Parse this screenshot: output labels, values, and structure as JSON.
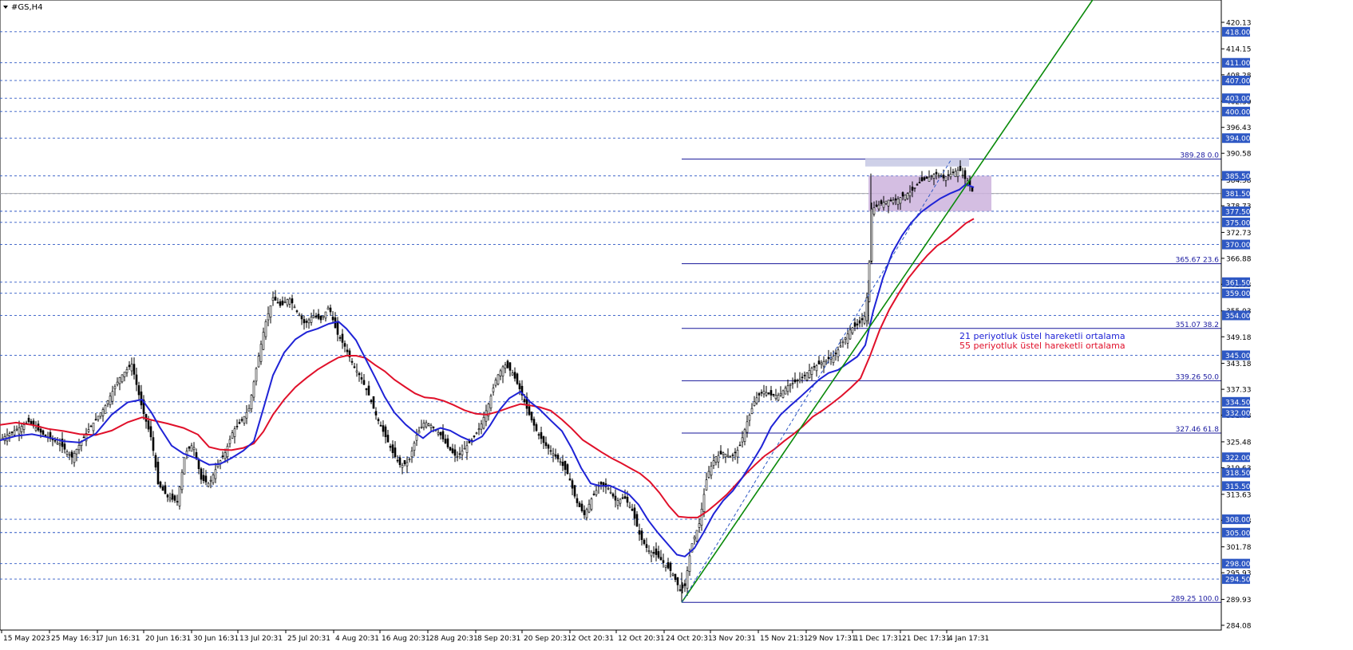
{
  "window": {
    "title": "#GS,H4"
  },
  "legend": {
    "items": [
      {
        "label": "21 periyotluk üstel hareketli ortalama",
        "color": "#1f23d6"
      },
      {
        "label": "55 periyotluk üstel hareketli ortalama",
        "color": "#e0102a"
      }
    ]
  },
  "colors": {
    "background": "#ffffff",
    "candle": "#000000",
    "ema21": "#1f23d6",
    "ema55": "#e0102a",
    "trendline": "#0a8a0a",
    "fib_line": "#16169a",
    "fib_label": "#1a1aa0",
    "sr_line": "#2e58c4",
    "sr_tag_bg": "#2e58c4",
    "sr_tag_text": "#ffffff",
    "range_box": "#cdb3dd",
    "range_box_top": "#c9cbe6",
    "axis_text": "#000000"
  },
  "chart_data": {
    "type": "candlestick",
    "symbol": "#GS",
    "timeframe": "H4",
    "ylim": [
      284.08,
      424.0
    ],
    "price_axis_ticks": [
      "420.13",
      "414.15",
      "408.28",
      "402.30",
      "396.43",
      "390.58",
      "384.58",
      "378.73",
      "372.73",
      "366.88",
      "361.03",
      "355.03",
      "349.18",
      "343.18",
      "337.33",
      "331.48",
      "325.48",
      "319.63",
      "313.63",
      "307.78",
      "301.78",
      "295.93",
      "289.93",
      "284.08"
    ],
    "support_resistance_levels": [
      "418.00",
      "411.00",
      "407.00",
      "403.00",
      "400.00",
      "394.00",
      "385.50",
      "381.50",
      "377.50",
      "375.00",
      "370.00",
      "361.50",
      "359.00",
      "354.00",
      "345.00",
      "334.50",
      "332.00",
      "322.00",
      "318.50",
      "315.50",
      "308.00",
      "305.00",
      "298.00",
      "294.50"
    ],
    "fibonacci_levels": [
      {
        "price": 389.28,
        "label": "389.28 0.0"
      },
      {
        "price": 365.67,
        "label": "365.67 23.6"
      },
      {
        "price": 351.07,
        "label": "351.07 38.2"
      },
      {
        "price": 339.26,
        "label": "339.26 50.0"
      },
      {
        "price": 327.46,
        "label": "327.46 61.8"
      },
      {
        "price": 289.25,
        "label": "289.25 100.0"
      }
    ],
    "x_axis_labels": [
      "15 May 2023",
      "25 May 16:31",
      "7 Jun 16:31",
      "20 Jun 16:31",
      "30 Jun 16:31",
      "13 Jul 20:31",
      "25 Jul 20:31",
      "4 Aug 20:31",
      "16 Aug 20:31",
      "28 Aug 20:31",
      "8 Sep 20:31",
      "20 Sep 20:31",
      "2 Oct 20:31",
      "12 Oct 20:31",
      "24 Oct 20:31",
      "3 Nov 20:31",
      "15 Nov 21:31",
      "29 Nov 17:31",
      "11 Dec 17:31",
      "21 Dec 17:31",
      "4 Jan 17:31"
    ],
    "close_path": [
      [
        0,
        326
      ],
      [
        18,
        328
      ],
      [
        36,
        330
      ],
      [
        55,
        327
      ],
      [
        75,
        325
      ],
      [
        90,
        322
      ],
      [
        110,
        328
      ],
      [
        130,
        333
      ],
      [
        150,
        340
      ],
      [
        165,
        343
      ],
      [
        178,
        333
      ],
      [
        190,
        326
      ],
      [
        198,
        316
      ],
      [
        210,
        313
      ],
      [
        222,
        312
      ],
      [
        232,
        323
      ],
      [
        242,
        325
      ],
      [
        252,
        317
      ],
      [
        262,
        316
      ],
      [
        272,
        320
      ],
      [
        282,
        323
      ],
      [
        292,
        328
      ],
      [
        302,
        330
      ],
      [
        312,
        333
      ],
      [
        322,
        343
      ],
      [
        332,
        352
      ],
      [
        342,
        358
      ],
      [
        352,
        356
      ],
      [
        362,
        358
      ],
      [
        372,
        355
      ],
      [
        382,
        352
      ],
      [
        392,
        354
      ],
      [
        402,
        353
      ],
      [
        412,
        356
      ],
      [
        422,
        350
      ],
      [
        432,
        347
      ],
      [
        442,
        343
      ],
      [
        452,
        340
      ],
      [
        462,
        336
      ],
      [
        472,
        331
      ],
      [
        482,
        327
      ],
      [
        492,
        323
      ],
      [
        502,
        320
      ],
      [
        512,
        321
      ],
      [
        522,
        327
      ],
      [
        532,
        330
      ],
      [
        542,
        329
      ],
      [
        552,
        327
      ],
      [
        562,
        324
      ],
      [
        572,
        322
      ],
      [
        582,
        324
      ],
      [
        592,
        326
      ],
      [
        602,
        329
      ],
      [
        612,
        334
      ],
      [
        622,
        340
      ],
      [
        632,
        343
      ],
      [
        642,
        341
      ],
      [
        652,
        337
      ],
      [
        662,
        332
      ],
      [
        672,
        328
      ],
      [
        682,
        325
      ],
      [
        692,
        323
      ],
      [
        702,
        321
      ],
      [
        712,
        318
      ],
      [
        722,
        312
      ],
      [
        732,
        309
      ],
      [
        742,
        313
      ],
      [
        752,
        316
      ],
      [
        762,
        315
      ],
      [
        772,
        312
      ],
      [
        782,
        313
      ],
      [
        792,
        310
      ],
      [
        802,
        304
      ],
      [
        812,
        301
      ],
      [
        822,
        300
      ],
      [
        832,
        298
      ],
      [
        842,
        296
      ],
      [
        852,
        292
      ],
      [
        858,
        293
      ],
      [
        866,
        302
      ],
      [
        876,
        307
      ],
      [
        886,
        318
      ],
      [
        896,
        322
      ],
      [
        906,
        323
      ],
      [
        916,
        322
      ],
      [
        926,
        324
      ],
      [
        936,
        330
      ],
      [
        946,
        335
      ],
      [
        956,
        337
      ],
      [
        966,
        336
      ],
      [
        976,
        336
      ],
      [
        986,
        338
      ],
      [
        996,
        339
      ],
      [
        1006,
        340
      ],
      [
        1016,
        342
      ],
      [
        1026,
        343
      ],
      [
        1036,
        344
      ],
      [
        1046,
        345
      ],
      [
        1056,
        348
      ],
      [
        1066,
        351
      ],
      [
        1076,
        352
      ],
      [
        1084,
        354
      ],
      [
        1088,
        362
      ],
      [
        1092,
        378
      ],
      [
        1102,
        379
      ],
      [
        1112,
        380
      ],
      [
        1122,
        380
      ],
      [
        1132,
        381
      ],
      [
        1142,
        382
      ],
      [
        1152,
        384
      ],
      [
        1162,
        385
      ],
      [
        1172,
        386
      ],
      [
        1182,
        385
      ],
      [
        1192,
        386
      ],
      [
        1202,
        387
      ],
      [
        1208,
        385
      ],
      [
        1214,
        384
      ],
      [
        1220,
        381
      ]
    ],
    "candle_range_tolerance": 1.2,
    "ema21_path": [
      [
        0,
        325.8
      ],
      [
        20,
        326.8
      ],
      [
        40,
        327.2
      ],
      [
        60,
        326.5
      ],
      [
        80,
        325.6
      ],
      [
        100,
        325.3
      ],
      [
        120,
        327.3
      ],
      [
        140,
        331.6
      ],
      [
        160,
        334.4
      ],
      [
        178,
        335.0
      ],
      [
        190,
        332.0
      ],
      [
        200,
        328.8
      ],
      [
        215,
        324.6
      ],
      [
        230,
        322.8
      ],
      [
        248,
        321.6
      ],
      [
        262,
        320.3
      ],
      [
        276,
        320.5
      ],
      [
        290,
        321.8
      ],
      [
        305,
        323.5
      ],
      [
        318,
        325.6
      ],
      [
        330,
        333.0
      ],
      [
        342,
        340.5
      ],
      [
        356,
        345.6
      ],
      [
        370,
        348.6
      ],
      [
        384,
        350.2
      ],
      [
        398,
        351.0
      ],
      [
        412,
        352.1
      ],
      [
        424,
        352.6
      ],
      [
        434,
        351.0
      ],
      [
        446,
        348.4
      ],
      [
        458,
        344.2
      ],
      [
        470,
        340.0
      ],
      [
        482,
        335.6
      ],
      [
        494,
        332.1
      ],
      [
        508,
        329.4
      ],
      [
        520,
        327.6
      ],
      [
        530,
        326.3
      ],
      [
        540,
        327.8
      ],
      [
        552,
        328.6
      ],
      [
        564,
        328.0
      ],
      [
        578,
        326.6
      ],
      [
        592,
        325.5
      ],
      [
        604,
        326.7
      ],
      [
        614,
        329.2
      ],
      [
        626,
        332.7
      ],
      [
        638,
        335.3
      ],
      [
        652,
        336.8
      ],
      [
        664,
        334.5
      ],
      [
        676,
        332.8
      ],
      [
        690,
        330.3
      ],
      [
        704,
        327.9
      ],
      [
        716,
        324.1
      ],
      [
        728,
        319.6
      ],
      [
        740,
        316.1
      ],
      [
        752,
        315.5
      ],
      [
        764,
        315.6
      ],
      [
        776,
        314.6
      ],
      [
        788,
        313.6
      ],
      [
        800,
        311.3
      ],
      [
        812,
        307.8
      ],
      [
        824,
        305.0
      ],
      [
        836,
        302.5
      ],
      [
        848,
        300.0
      ],
      [
        858,
        299.6
      ],
      [
        870,
        301.5
      ],
      [
        882,
        305.2
      ],
      [
        894,
        309.2
      ],
      [
        906,
        312.2
      ],
      [
        918,
        314.4
      ],
      [
        930,
        317.4
      ],
      [
        942,
        320.8
      ],
      [
        954,
        324.4
      ],
      [
        966,
        328.8
      ],
      [
        978,
        331.6
      ],
      [
        990,
        333.6
      ],
      [
        1002,
        335.5
      ],
      [
        1014,
        337.5
      ],
      [
        1026,
        339.5
      ],
      [
        1038,
        341.0
      ],
      [
        1050,
        341.7
      ],
      [
        1062,
        343.2
      ],
      [
        1074,
        344.7
      ],
      [
        1084,
        347.3
      ],
      [
        1094,
        355.0
      ],
      [
        1106,
        362.4
      ],
      [
        1118,
        368.2
      ],
      [
        1130,
        372.0
      ],
      [
        1142,
        375.0
      ],
      [
        1154,
        377.3
      ],
      [
        1166,
        378.9
      ],
      [
        1178,
        380.4
      ],
      [
        1190,
        381.5
      ],
      [
        1202,
        382.4
      ],
      [
        1210,
        383.6
      ],
      [
        1220,
        382.9
      ]
    ],
    "ema55_path": [
      [
        0,
        329.3
      ],
      [
        20,
        329.8
      ],
      [
        40,
        329.3
      ],
      [
        60,
        328.4
      ],
      [
        80,
        327.9
      ],
      [
        100,
        327.2
      ],
      [
        120,
        327.0
      ],
      [
        140,
        328.0
      ],
      [
        160,
        329.9
      ],
      [
        178,
        331.0
      ],
      [
        190,
        330.4
      ],
      [
        210,
        329.6
      ],
      [
        230,
        328.6
      ],
      [
        248,
        327.1
      ],
      [
        262,
        324.3
      ],
      [
        276,
        323.7
      ],
      [
        290,
        323.6
      ],
      [
        305,
        324.1
      ],
      [
        318,
        325.1
      ],
      [
        330,
        327.8
      ],
      [
        342,
        331.6
      ],
      [
        356,
        335.0
      ],
      [
        370,
        337.8
      ],
      [
        384,
        339.9
      ],
      [
        398,
        341.8
      ],
      [
        412,
        343.3
      ],
      [
        424,
        344.5
      ],
      [
        434,
        344.9
      ],
      [
        446,
        344.9
      ],
      [
        458,
        344.4
      ],
      [
        470,
        342.8
      ],
      [
        482,
        341.4
      ],
      [
        494,
        339.5
      ],
      [
        508,
        337.8
      ],
      [
        520,
        336.4
      ],
      [
        532,
        335.5
      ],
      [
        544,
        335.3
      ],
      [
        556,
        334.7
      ],
      [
        568,
        333.8
      ],
      [
        582,
        332.6
      ],
      [
        596,
        331.8
      ],
      [
        610,
        331.6
      ],
      [
        624,
        332.3
      ],
      [
        638,
        333.2
      ],
      [
        652,
        334.0
      ],
      [
        664,
        333.7
      ],
      [
        676,
        333.3
      ],
      [
        690,
        332.5
      ],
      [
        704,
        330.5
      ],
      [
        716,
        328.5
      ],
      [
        730,
        325.9
      ],
      [
        742,
        324.5
      ],
      [
        754,
        323.1
      ],
      [
        766,
        321.8
      ],
      [
        778,
        320.7
      ],
      [
        790,
        319.5
      ],
      [
        802,
        318.3
      ],
      [
        814,
        316.5
      ],
      [
        826,
        314.0
      ],
      [
        838,
        311.0
      ],
      [
        850,
        308.6
      ],
      [
        862,
        308.4
      ],
      [
        874,
        308.4
      ],
      [
        886,
        309.8
      ],
      [
        898,
        311.6
      ],
      [
        910,
        313.5
      ],
      [
        922,
        315.8
      ],
      [
        934,
        318.2
      ],
      [
        946,
        320.3
      ],
      [
        958,
        322.3
      ],
      [
        970,
        323.8
      ],
      [
        982,
        325.6
      ],
      [
        994,
        327.2
      ],
      [
        1006,
        329.0
      ],
      [
        1018,
        331.1
      ],
      [
        1030,
        332.5
      ],
      [
        1042,
        334.1
      ],
      [
        1054,
        335.8
      ],
      [
        1066,
        337.7
      ],
      [
        1078,
        339.8
      ],
      [
        1090,
        344.9
      ],
      [
        1102,
        350.7
      ],
      [
        1114,
        355.3
      ],
      [
        1126,
        359.0
      ],
      [
        1138,
        362.4
      ],
      [
        1150,
        365.1
      ],
      [
        1162,
        367.6
      ],
      [
        1174,
        369.7
      ],
      [
        1186,
        371.1
      ],
      [
        1198,
        372.9
      ],
      [
        1210,
        374.8
      ],
      [
        1220,
        375.8
      ]
    ],
    "trendlines": [
      {
        "name": "uptrend",
        "x1": 854,
        "y1": 289.25,
        "x2": 1370,
        "y2": 425.5
      },
      {
        "name": "fib-guide",
        "x1": 854,
        "y1": 289.25,
        "x2": 1192,
        "y2": 389.28,
        "dashed": true
      }
    ],
    "range_box": {
      "x1": 1088,
      "x2": 1242,
      "y_low": 377.5,
      "y_high": 385.5
    },
    "range_box_top": {
      "x1": 1084,
      "x2": 1214,
      "y_low": 387.6,
      "y_high": 389.5
    },
    "horizontal_grey_line": 381.5
  }
}
